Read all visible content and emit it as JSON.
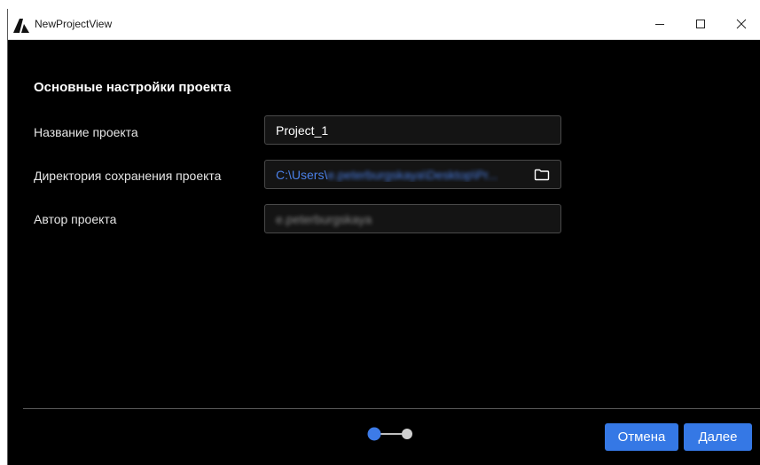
{
  "window": {
    "title": "NewProjectView",
    "logo_icon": "app-logo-icon",
    "controls": {
      "minimize_icon": "minimize-icon",
      "maximize_icon": "maximize-icon",
      "close_icon": "close-icon"
    }
  },
  "form": {
    "section_title": "Основные настройки проекта",
    "fields": {
      "project_name": {
        "label": "Название проекта",
        "value": "Project_1"
      },
      "save_directory": {
        "label": "Директория сохранения проекта",
        "value_prefix": "C:\\Users\\",
        "value_rest": "e.peterburgskaya\\Desktop\\Pr...",
        "action_icon": "folder-icon"
      },
      "author": {
        "label": "Автор проекта",
        "value": "e.peterburgskaya"
      }
    }
  },
  "footer": {
    "stepper": {
      "current_step": 1,
      "total_steps": 2,
      "active_color": "#3d7be8",
      "inactive_color": "#d0d0d0"
    },
    "cancel_label": "Отмена",
    "next_label": "Далее"
  },
  "colors": {
    "background": "#000000",
    "accent": "#3578e5",
    "path_text": "#4a7fe6"
  }
}
